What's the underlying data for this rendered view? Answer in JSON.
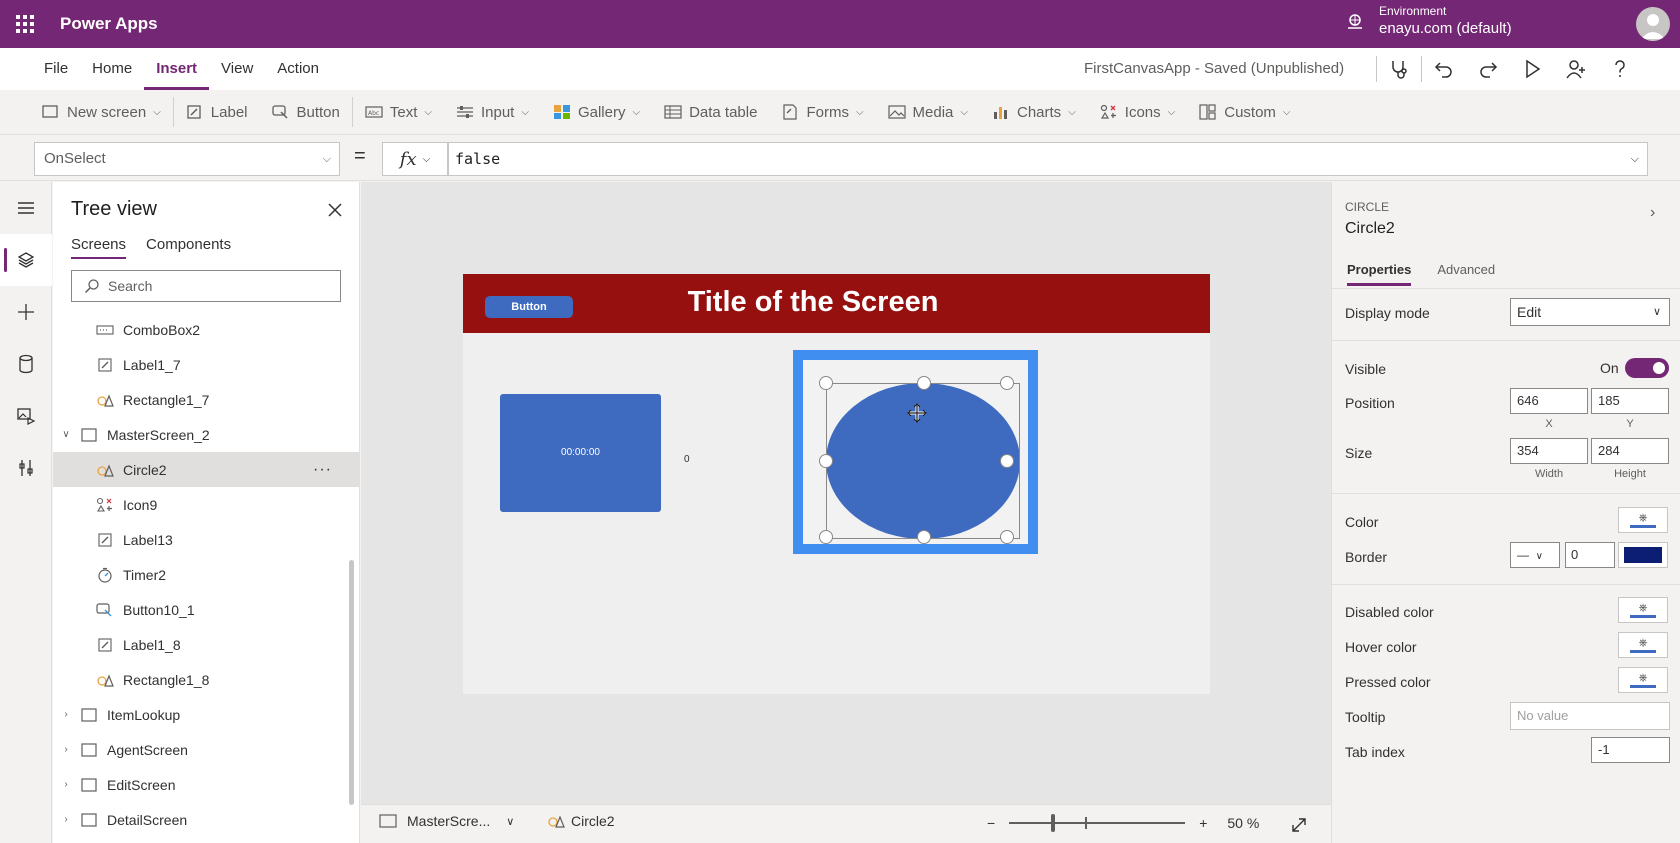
{
  "topbar": {
    "app_name": "Power Apps",
    "environment_label": "Environment",
    "environment_value": "enayu.com (default)"
  },
  "menubar": {
    "items": [
      "File",
      "Home",
      "Insert",
      "View",
      "Action"
    ],
    "active": "Insert",
    "saved_status": "FirstCanvasApp - Saved (Unpublished)"
  },
  "ribbon": {
    "items": [
      "New screen",
      "Label",
      "Button",
      "Text",
      "Input",
      "Gallery",
      "Data table",
      "Forms",
      "Media",
      "Charts",
      "Icons",
      "Custom"
    ]
  },
  "formula": {
    "property": "OnSelect",
    "fx_label": "fx",
    "value": "false"
  },
  "tree": {
    "title": "Tree view",
    "tabs": [
      "Screens",
      "Components"
    ],
    "search_placeholder": "Search",
    "items": [
      {
        "label": "ComboBox2",
        "icon": "combobox-icon"
      },
      {
        "label": "Label1_7",
        "icon": "label-edit-icon"
      },
      {
        "label": "Rectangle1_7",
        "icon": "shapes-icon"
      },
      {
        "label": "MasterScreen_2",
        "icon": "screen-icon"
      },
      {
        "label": "Circle2",
        "icon": "shapes-icon"
      },
      {
        "label": "Icon9",
        "icon": "icons-icon"
      },
      {
        "label": "Label13",
        "icon": "label-edit-icon"
      },
      {
        "label": "Timer2",
        "icon": "timer-icon"
      },
      {
        "label": "Button10_1",
        "icon": "button-icon"
      },
      {
        "label": "Label1_8",
        "icon": "label-edit-icon"
      },
      {
        "label": "Rectangle1_8",
        "icon": "shapes-icon"
      },
      {
        "label": "ItemLookup",
        "icon": "screen-icon"
      },
      {
        "label": "AgentScreen",
        "icon": "screen-icon"
      },
      {
        "label": "EditScreen",
        "icon": "screen-icon"
      },
      {
        "label": "DetailScreen",
        "icon": "screen-icon"
      }
    ]
  },
  "canvas": {
    "button_text": "Button",
    "title_text": "Title of the Screen",
    "timer_text": "00:00:00",
    "label_text": "0",
    "colors": {
      "header": "#961010",
      "shape": "#3e6bc0",
      "selection": "#3f8ef0"
    }
  },
  "statusbar": {
    "screen_name": "MasterScre...",
    "component_name": "Circle2",
    "zoom_minus": "−",
    "zoom_plus": "+",
    "zoom_value": "50",
    "zoom_unit": "%"
  },
  "properties": {
    "type": "CIRCLE",
    "name": "Circle2",
    "tabs": [
      "Properties",
      "Advanced"
    ],
    "display_mode_label": "Display mode",
    "display_mode_value": "Edit",
    "visible_label": "Visible",
    "visible_state": "On",
    "position_label": "Position",
    "position_x": "646",
    "position_y": "185",
    "x_caption": "X",
    "y_caption": "Y",
    "size_label": "Size",
    "size_width": "354",
    "size_height": "284",
    "width_caption": "Width",
    "height_caption": "Height",
    "color_label": "Color",
    "border_label": "Border",
    "border_width": "0",
    "disabled_color_label": "Disabled color",
    "hover_color_label": "Hover color",
    "pressed_color_label": "Pressed color",
    "tooltip_label": "Tooltip",
    "tooltip_placeholder": "No value",
    "tab_index_label": "Tab index",
    "tab_index_value": "-1",
    "border_color": "#0c1e74"
  }
}
